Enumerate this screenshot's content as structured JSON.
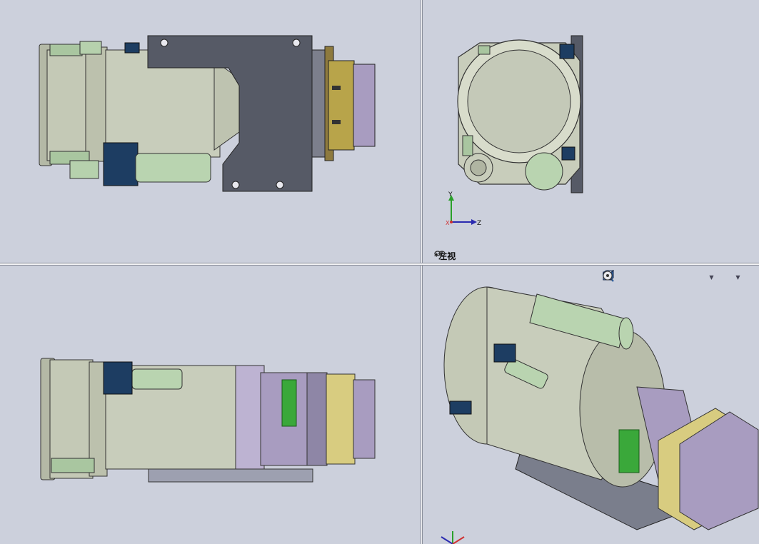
{
  "viewports": {
    "top_left": {},
    "top_right": {
      "view_label": "*左视"
    },
    "bottom_left": {},
    "bottom_right": {}
  },
  "triad": {
    "y_label": "Y",
    "z_label": "Z",
    "x_label": "X"
  },
  "toolbar": {
    "icons": [
      "zoom-to-fit-icon",
      "zoom-to-area-icon",
      "previous-view-icon",
      "section-view-icon",
      "dynamic-annotation-icon",
      "view-orientation-icon",
      "display-style-icon",
      "hide-show-icon"
    ]
  },
  "colors": {
    "background": "#ccd0dc",
    "lens_body": "#c8cdbb",
    "bracket": "#565a66",
    "sensor_block": "#a89cc0",
    "mount_plate": "#b8a44a",
    "green_part": "#3aa83a",
    "dark_blue": "#1d3d62",
    "motor": "#b9d4b0"
  }
}
